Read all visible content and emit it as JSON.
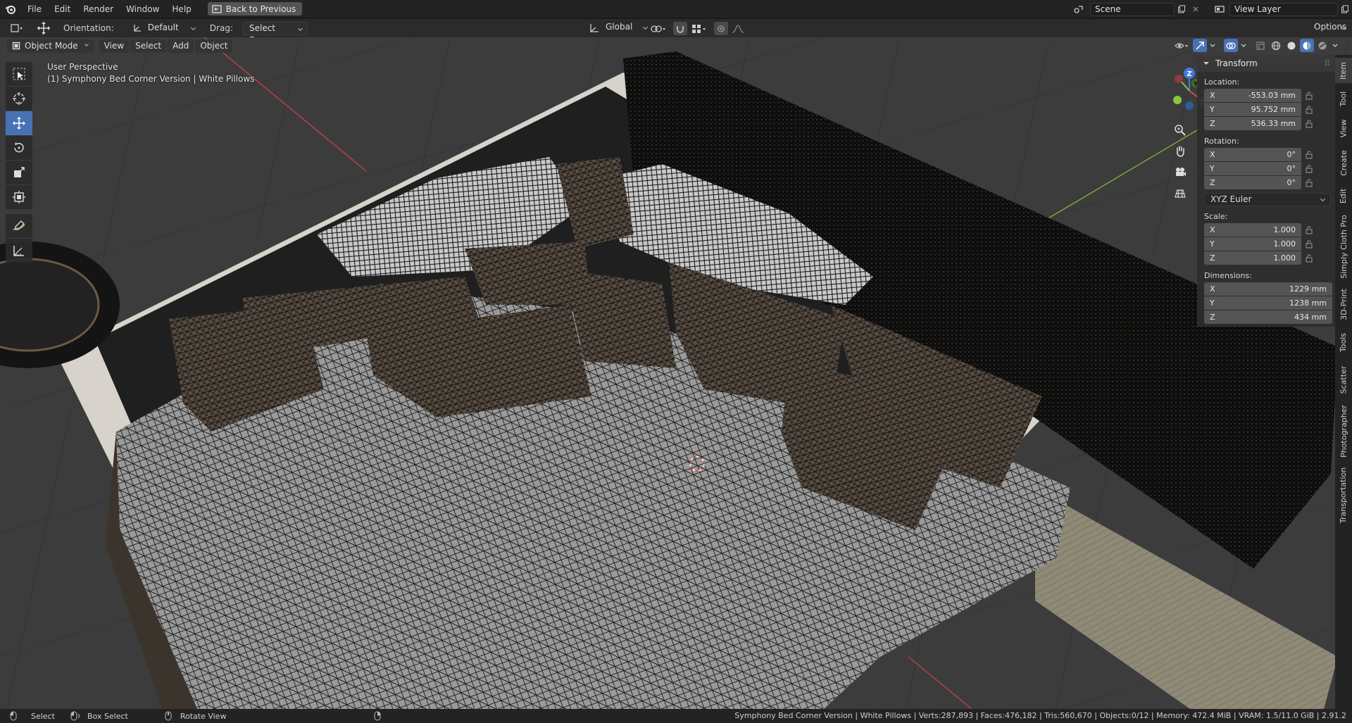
{
  "topbar": {
    "menus": [
      "File",
      "Edit",
      "Render",
      "Window",
      "Help"
    ],
    "back_label": "Back to Previous",
    "scene_value": "Scene",
    "viewlayer_value": "View Layer"
  },
  "toolheader": {
    "orientation_label": "Orientation:",
    "orientation_value": "Default",
    "drag_label": "Drag:",
    "drag_value": "Select Box",
    "transform_orientation": "Global",
    "options_label": "Options"
  },
  "viewport_header": {
    "mode": "Object Mode",
    "menus": [
      "View",
      "Select",
      "Add",
      "Object"
    ]
  },
  "overlay": {
    "perspective": "User Perspective",
    "object_info": "(1) Symphony Bed Corner Version | White Pillows"
  },
  "gizmo": {
    "x": "X",
    "y": "Y",
    "z": "Z"
  },
  "npanel": {
    "title": "Transform",
    "location_label": "Location:",
    "location": [
      {
        "axis": "X",
        "value": "-553.03 mm"
      },
      {
        "axis": "Y",
        "value": "95.752 mm"
      },
      {
        "axis": "Z",
        "value": "536.33 mm"
      }
    ],
    "rotation_label": "Rotation:",
    "rotation": [
      {
        "axis": "X",
        "value": "0°"
      },
      {
        "axis": "Y",
        "value": "0°"
      },
      {
        "axis": "Z",
        "value": "0°"
      }
    ],
    "rotation_mode": "XYZ Euler",
    "scale_label": "Scale:",
    "scale": [
      {
        "axis": "X",
        "value": "1.000"
      },
      {
        "axis": "Y",
        "value": "1.000"
      },
      {
        "axis": "Z",
        "value": "1.000"
      }
    ],
    "dimensions_label": "Dimensions:",
    "dimensions": [
      {
        "axis": "X",
        "value": "1229 mm"
      },
      {
        "axis": "Y",
        "value": "1238 mm"
      },
      {
        "axis": "Z",
        "value": "434 mm"
      }
    ]
  },
  "sidetabs": [
    "Item",
    "Tool",
    "View",
    "Create",
    "Edit",
    "Simply Cloth Pro",
    "3D-Print",
    "Tools",
    "Scatter",
    "Photographer",
    "Transportation"
  ],
  "statusbar": {
    "select": "Select",
    "box_select": "Box Select",
    "rotate_view": "Rotate View",
    "info": "Symphony Bed Corner Version | White Pillows | Verts:287,893 | Faces:476,182 | Tris:560,670 | Objects:0/12 | Memory: 472.4 MiB | VRAM: 1.5/11.0 GiB | 2.91.2"
  },
  "colors": {
    "accent": "#4772b3",
    "axis_x": "#e0454f",
    "axis_y": "#8bc63f",
    "axis_z": "#3f7bd9"
  }
}
